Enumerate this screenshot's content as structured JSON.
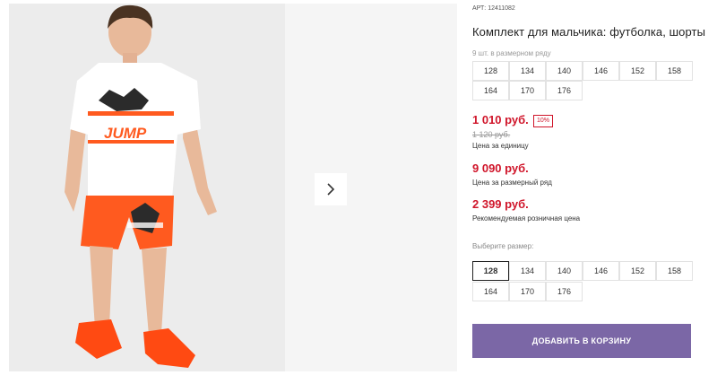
{
  "product": {
    "article_label": "АРТ:",
    "article_number": "12411082",
    "title": "Комплект для мальчика: футболка, шорты",
    "photo_print_text": "JUMP",
    "row_note": "9 шт. в размерном ряду",
    "row_sizes": [
      "128",
      "134",
      "140",
      "146",
      "152",
      "158",
      "164",
      "170",
      "176"
    ],
    "unit_price": "1 010 руб.",
    "discount_badge": "10%",
    "old_price": "1 120 руб.",
    "unit_price_caption": "Цена за единицу",
    "row_price": "9 090 руб.",
    "row_price_caption": "Цена за размерный ряд",
    "rrp_price": "2 399 руб.",
    "rrp_caption": "Рекомендуемая розничная цена",
    "choose_size_label": "Выберите размер:",
    "size_options": [
      "128",
      "134",
      "140",
      "146",
      "152",
      "158",
      "164",
      "170",
      "176"
    ],
    "selected_size": "128",
    "add_to_cart_label": "ДОБАВИТЬ В КОРЗИНУ"
  },
  "gallery": {
    "next_icon": "chevron-right-icon"
  },
  "colors": {
    "price_red": "#d0152a",
    "button_purple": "#7b67a6",
    "shorts_orange": "#ff5a1f"
  }
}
